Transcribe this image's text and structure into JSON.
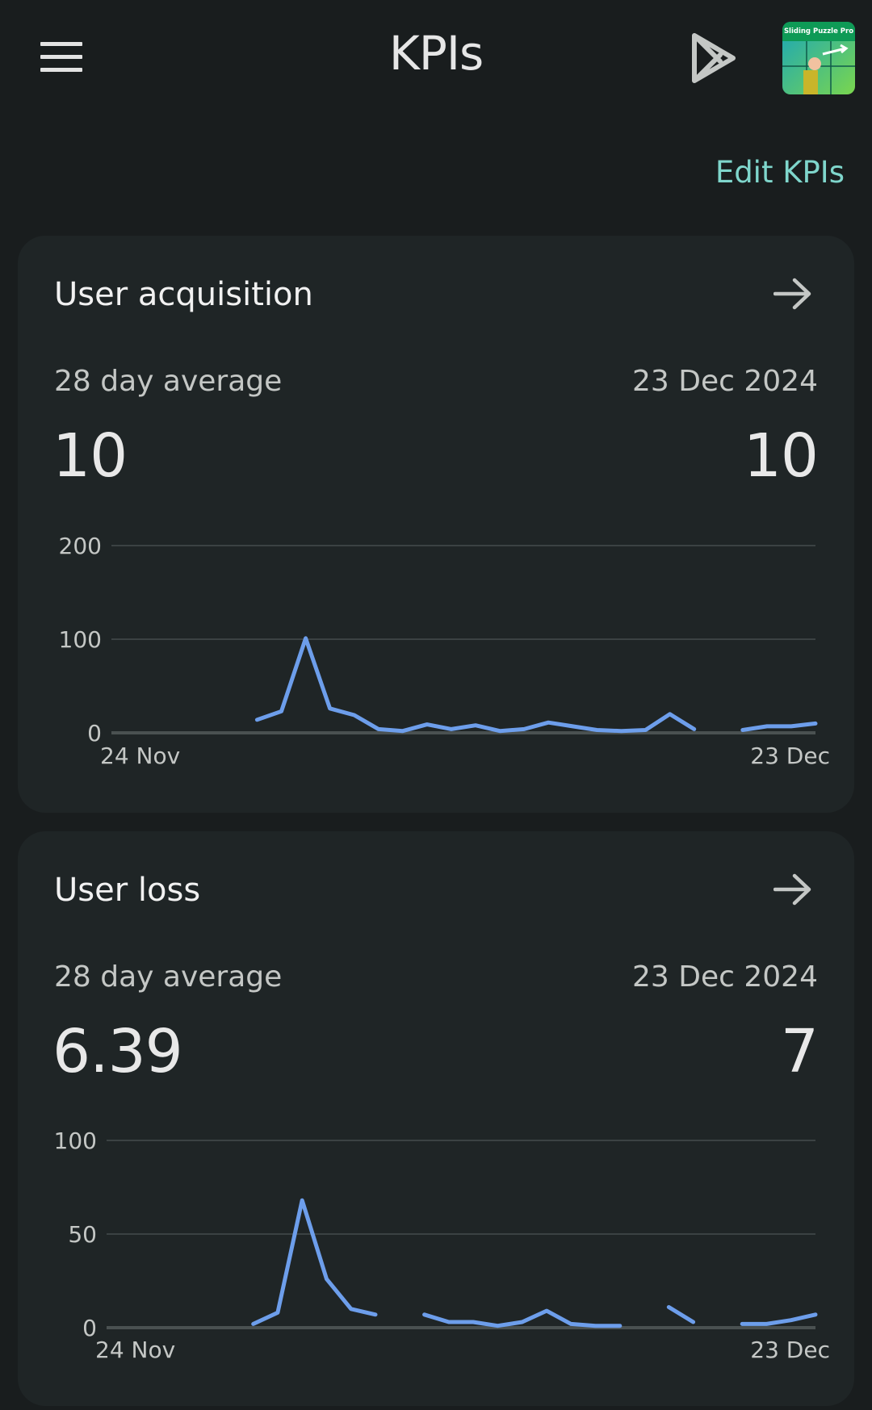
{
  "header": {
    "menu_icon": "menu-icon",
    "title": "KPIs",
    "play_icon": "google-play-icon",
    "app_icon_label": "Sliding Puzzle Pro"
  },
  "edit_link": "Edit KPIs",
  "colors": {
    "background": "#191d1e",
    "card": "#1f2526",
    "accent": "#7fd6cc",
    "line": "#6d9eeb"
  },
  "cards": [
    {
      "title": "User acquisition",
      "avg_label": "28 day average",
      "avg_value": "10",
      "date_label": "23 Dec 2024",
      "date_value": "10",
      "arrow_icon": "arrow-right-icon"
    },
    {
      "title": "User loss",
      "avg_label": "28 day average",
      "avg_value": "6.39",
      "date_label": "23 Dec 2024",
      "date_value": "7",
      "arrow_icon": "arrow-right-icon"
    }
  ],
  "chart_data": [
    {
      "type": "line",
      "title": "User acquisition",
      "x_labels": [
        "24 Nov",
        "23 Dec"
      ],
      "y_ticks": [
        0,
        100,
        200
      ],
      "ylim": [
        0,
        200
      ],
      "grid": true,
      "x": [
        "24 Nov",
        "25 Nov",
        "26 Nov",
        "27 Nov",
        "28 Nov",
        "29 Nov",
        "30 Nov",
        "1 Dec",
        "2 Dec",
        "3 Dec",
        "4 Dec",
        "5 Dec",
        "6 Dec",
        "7 Dec",
        "8 Dec",
        "9 Dec",
        "10 Dec",
        "11 Dec",
        "12 Dec",
        "13 Dec",
        "14 Dec",
        "15 Dec",
        "16 Dec",
        "17 Dec",
        "18 Dec",
        "19 Dec",
        "20 Dec",
        "21 Dec",
        "22 Dec",
        "23 Dec"
      ],
      "values": [
        null,
        null,
        null,
        null,
        null,
        null,
        14,
        23,
        101,
        26,
        19,
        4,
        2,
        9,
        4,
        8,
        2,
        4,
        11,
        7,
        3,
        2,
        3,
        20,
        4,
        null,
        3,
        7,
        7,
        10
      ]
    },
    {
      "type": "line",
      "title": "User loss",
      "x_labels": [
        "24 Nov",
        "23 Dec"
      ],
      "y_ticks": [
        0,
        50,
        100
      ],
      "ylim": [
        0,
        100
      ],
      "grid": true,
      "x": [
        "24 Nov",
        "25 Nov",
        "26 Nov",
        "27 Nov",
        "28 Nov",
        "29 Nov",
        "30 Nov",
        "1 Dec",
        "2 Dec",
        "3 Dec",
        "4 Dec",
        "5 Dec",
        "6 Dec",
        "7 Dec",
        "8 Dec",
        "9 Dec",
        "10 Dec",
        "11 Dec",
        "12 Dec",
        "13 Dec",
        "14 Dec",
        "15 Dec",
        "16 Dec",
        "17 Dec",
        "18 Dec",
        "19 Dec",
        "20 Dec",
        "21 Dec",
        "22 Dec",
        "23 Dec"
      ],
      "values": [
        null,
        null,
        null,
        null,
        null,
        null,
        2,
        8,
        68,
        26,
        10,
        7,
        null,
        7,
        3,
        3,
        1,
        3,
        9,
        2,
        1,
        1,
        null,
        11,
        3,
        null,
        2,
        2,
        4,
        7
      ]
    }
  ]
}
